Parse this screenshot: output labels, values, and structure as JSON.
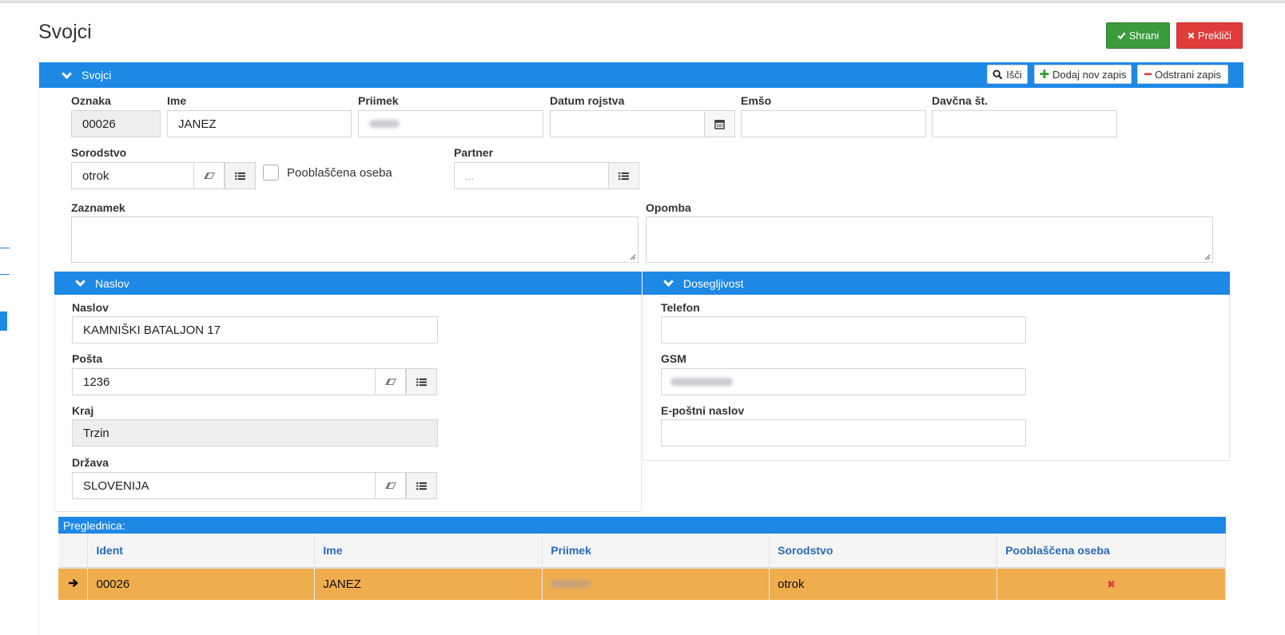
{
  "page": {
    "title": "Svojci"
  },
  "actions": {
    "save": "Shrani",
    "cancel": "Prekliči"
  },
  "section_main": {
    "title": "Svojci",
    "search_label": "Išči",
    "add_label": "Dodaj nov zapis",
    "remove_label": "Odstrani zapis"
  },
  "form": {
    "oznaka": {
      "label": "Oznaka",
      "value": "00026"
    },
    "ime": {
      "label": "Ime",
      "value": "JANEZ"
    },
    "priimek": {
      "label": "Priimek",
      "value": ""
    },
    "datum_rojstva": {
      "label": "Datum rojstva",
      "value": ""
    },
    "emso": {
      "label": "Emšo",
      "value": ""
    },
    "davcna": {
      "label": "Davčna št.",
      "value": ""
    },
    "sorodstvo": {
      "label": "Sorodstvo",
      "value": "otrok"
    },
    "pooblascena": {
      "label": "Pooblaščena oseba",
      "checked": false
    },
    "partner": {
      "label": "Partner",
      "placeholder": "..."
    },
    "zaznamek": {
      "label": "Zaznamek",
      "value": ""
    },
    "opomba": {
      "label": "Opomba",
      "value": ""
    }
  },
  "naslov": {
    "title": "Naslov",
    "naslov": {
      "label": "Naslov",
      "value": "KAMNIŠKI BATALJON 17"
    },
    "posta": {
      "label": "Pošta",
      "value": "1236"
    },
    "kraj": {
      "label": "Kraj",
      "value": "Trzin"
    },
    "drzava": {
      "label": "Država",
      "value": "SLOVENIJA"
    }
  },
  "doseglj": {
    "title": "Dosegljivost",
    "telefon": {
      "label": "Telefon",
      "value": ""
    },
    "gsm": {
      "label": "GSM",
      "value": ""
    },
    "email": {
      "label": "E-poštni naslov",
      "value": ""
    }
  },
  "grid": {
    "title": "Preglednica:",
    "columns": [
      "Ident",
      "Ime",
      "Priimek",
      "Sorodstvo",
      "Pooblaščena oseba"
    ],
    "rows": [
      {
        "ident": "00026",
        "ime": "JANEZ",
        "priimek": "",
        "sorodstvo": "otrok",
        "pooblascena": "✖"
      }
    ]
  },
  "colors": {
    "accent": "#1e88e5",
    "save": "#3c9c3c",
    "cancel": "#e03c3c",
    "row_selected": "#f0ad4e"
  },
  "icons": [
    "check-icon",
    "times-icon",
    "search-icon",
    "plus-icon",
    "minus-icon",
    "chevron-down-icon",
    "calendar-icon",
    "eraser-icon",
    "list-icon",
    "arrow-right-icon"
  ]
}
